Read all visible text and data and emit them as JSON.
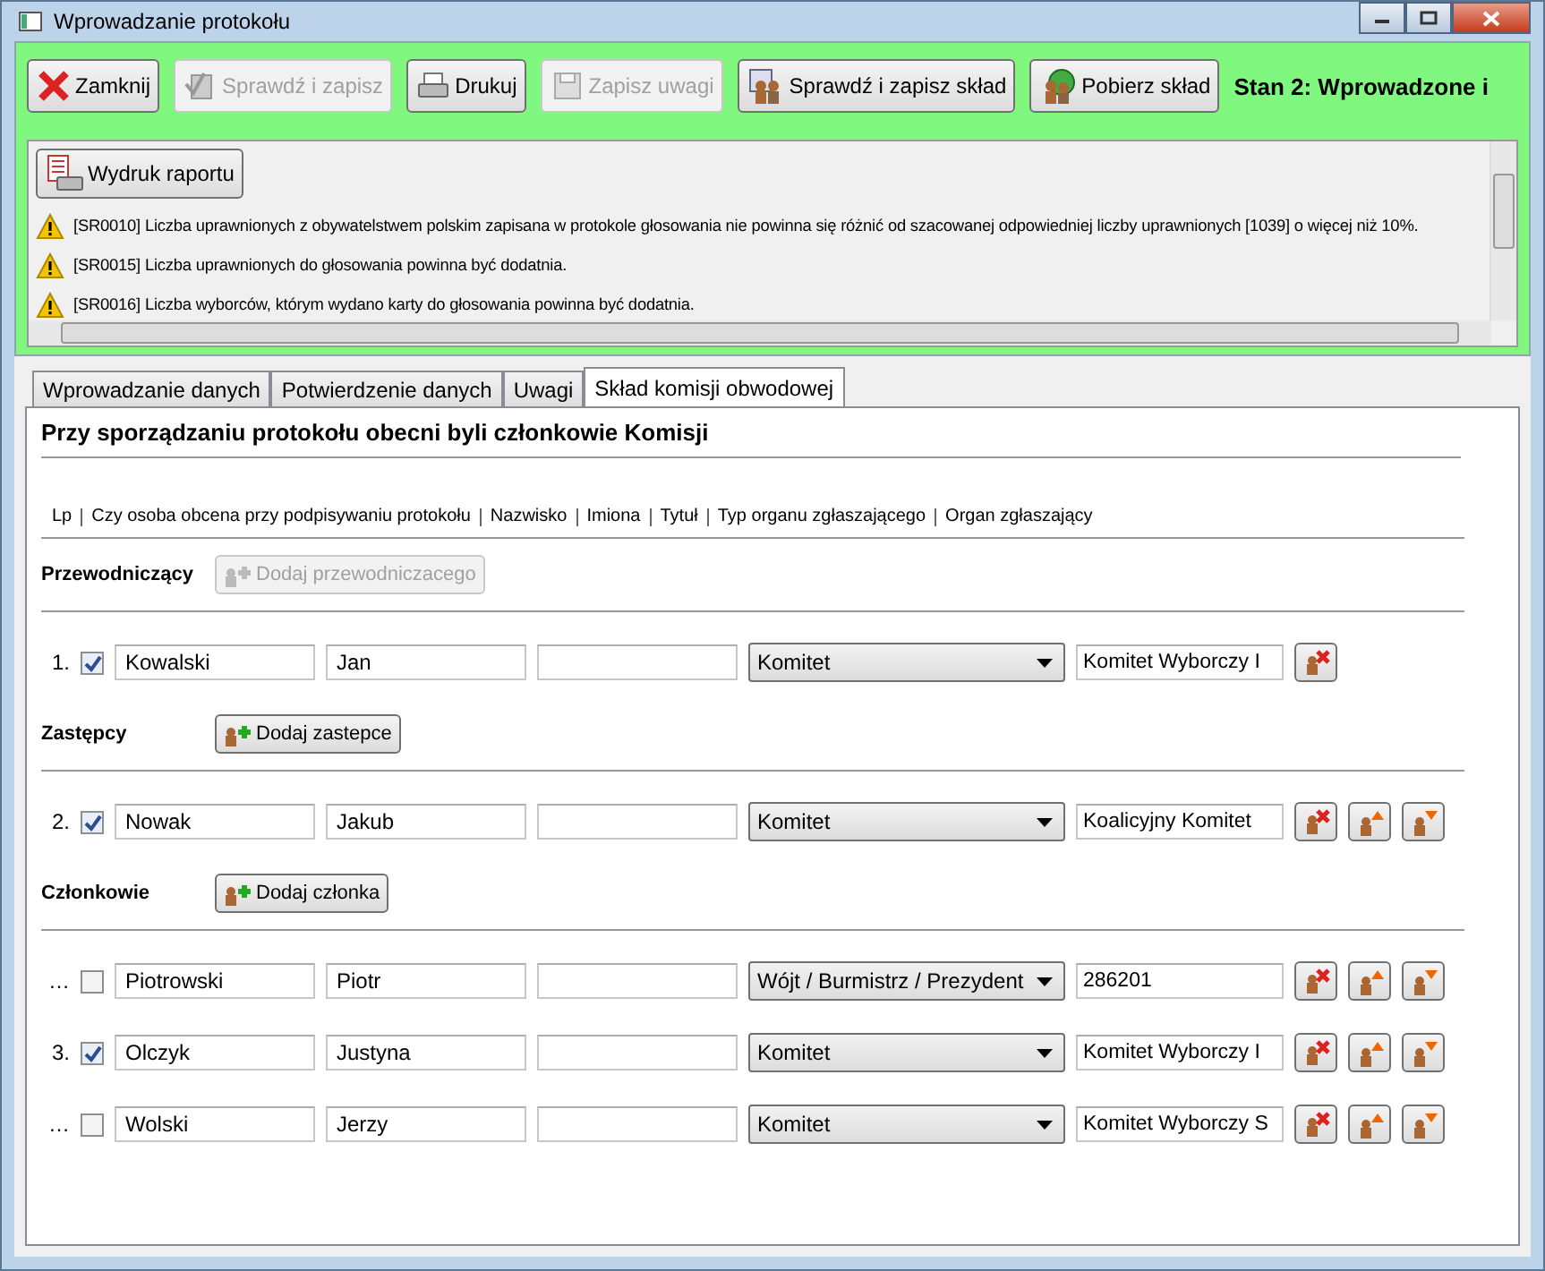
{
  "window": {
    "title": "Wprowadzanie protokołu"
  },
  "toolbar": {
    "buttons": [
      {
        "label": "Zamknij",
        "disabled": false,
        "kind": "close"
      },
      {
        "label": "Sprawdź i zapisz",
        "disabled": true,
        "kind": "check"
      },
      {
        "label": "Drukuj",
        "disabled": false,
        "kind": "print"
      },
      {
        "label": "Zapisz uwagi",
        "disabled": true,
        "kind": "save"
      },
      {
        "label": "Sprawdź i zapisz skład",
        "disabled": false,
        "kind": "people-save"
      },
      {
        "label": "Pobierz skład",
        "disabled": false,
        "kind": "people-download"
      }
    ],
    "status": "Stan 2: Wprowadzone i"
  },
  "report": {
    "button": "Wydruk raportu",
    "messages": [
      "[SR0010] Liczba uprawnionych z obywatelstwem polskim zapisana w protokole głosowania nie powinna się różnić od szacowanej odpowiedniej liczby uprawnionych [1039] o więcej niż 10%.",
      "[SR0015] Liczba uprawnionych do głosowania powinna być dodatnia.",
      "[SR0016] Liczba wyborców, którym wydano karty do głosowania powinna być dodatnia."
    ]
  },
  "tabs": [
    {
      "label": "Wprowadzanie danych",
      "selected": false
    },
    {
      "label": "Potwierdzenie danych",
      "selected": false
    },
    {
      "label": "Uwagi",
      "selected": false
    },
    {
      "label": "Skład komisji obwodowej",
      "selected": true
    }
  ],
  "heading": "Przy sporządzaniu protokołu obecni byli członkowie Komisji",
  "columns": [
    "Lp",
    "Czy osoba obcena przy podpisywaniu protokołu",
    "Nazwisko",
    "Imiona",
    "Tytuł",
    "Typ organu zgłaszającego",
    "Organ zgłaszający"
  ],
  "groups": [
    {
      "label": "Przewodniczący",
      "add_button": {
        "label": "Dodaj przewodniczacego",
        "disabled": true
      },
      "members": [
        {
          "lp": "1.",
          "present": true,
          "surname": "Kowalski",
          "given_names": "Jan",
          "organ_type": "Komitet",
          "organ": "Komitet Wyborczy I",
          "reorder": false
        }
      ]
    },
    {
      "label": "Zastępcy",
      "add_button": {
        "label": "Dodaj zastepce",
        "disabled": false
      },
      "members": [
        {
          "lp": "2.",
          "present": true,
          "surname": "Nowak",
          "given_names": "Jakub",
          "organ_type": "Komitet",
          "organ": "Koalicyjny Komitet",
          "reorder": true
        }
      ]
    },
    {
      "label": "Członkowie",
      "add_button": {
        "label": "Dodaj członka",
        "disabled": false
      },
      "members": [
        {
          "lp": "…",
          "present": false,
          "surname": "Piotrowski",
          "given_names": "Piotr",
          "organ_type": "Wójt / Burmistrz / Prezydent",
          "organ": "286201",
          "reorder": true
        },
        {
          "lp": "3.",
          "present": true,
          "surname": "Olczyk",
          "given_names": "Justyna",
          "organ_type": "Komitet",
          "organ": "Komitet Wyborczy I",
          "reorder": true
        },
        {
          "lp": "…",
          "present": false,
          "surname": "Wolski",
          "given_names": "Jerzy",
          "organ_type": "Komitet",
          "organ": "Komitet Wyborczy S",
          "reorder": true
        }
      ]
    }
  ]
}
